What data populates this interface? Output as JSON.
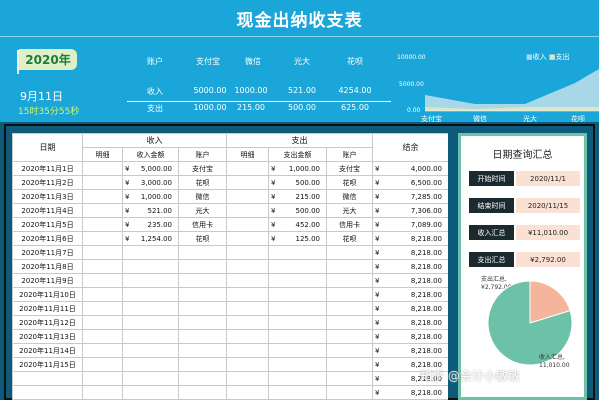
{
  "title": "现金出纳收支表",
  "badge": {
    "year": "2020年"
  },
  "today_date": "9月11日",
  "current_time": "15时35分55秒",
  "summary": {
    "headers": [
      "账户",
      "支付宝",
      "微信",
      "光大",
      "花呗"
    ],
    "rows": [
      {
        "label": "收入",
        "values": [
          "5000.00",
          "1000.00",
          "521.00",
          "4254.00"
        ]
      },
      {
        "label": "支出",
        "values": [
          "1000.00",
          "215.00",
          "500.00",
          "625.00"
        ]
      }
    ]
  },
  "mini_chart": {
    "legend": [
      "收入",
      "支出"
    ],
    "y_labels": [
      "10000.00",
      "5000.00",
      "0.00"
    ],
    "x_labels": [
      "支付宝",
      "微信",
      "光大",
      "花呗"
    ],
    "colors": {
      "income": "#a8d8e8",
      "expense": "#d9e7c7"
    }
  },
  "table": {
    "group_headers": {
      "date": "日期",
      "income": "收入",
      "expense": "支出",
      "balance": "结余"
    },
    "sub_headers": {
      "detail": "明细",
      "income_amount": "收入金额",
      "income_account": "账户",
      "expense_detail": "明细",
      "expense_amount": "支出金额",
      "expense_account": "账户"
    },
    "currency": "¥",
    "rows": [
      {
        "date": "2020年11月1日",
        "in_amt": "5,000.00",
        "in_acc": "支付宝",
        "out_amt": "1,000.00",
        "out_acc": "支付宝",
        "bal": "4,000.00"
      },
      {
        "date": "2020年11月2日",
        "in_amt": "3,000.00",
        "in_acc": "花呗",
        "out_amt": "500.00",
        "out_acc": "花呗",
        "bal": "6,500.00"
      },
      {
        "date": "2020年11月3日",
        "in_amt": "1,000.00",
        "in_acc": "微信",
        "out_amt": "215.00",
        "out_acc": "微信",
        "bal": "7,285.00"
      },
      {
        "date": "2020年11月4日",
        "in_amt": "521.00",
        "in_acc": "光大",
        "out_amt": "500.00",
        "out_acc": "光大",
        "bal": "7,306.00"
      },
      {
        "date": "2020年11月5日",
        "in_amt": "235.00",
        "in_acc": "信用卡",
        "out_amt": "452.00",
        "out_acc": "信用卡",
        "bal": "7,089.00"
      },
      {
        "date": "2020年11月6日",
        "in_amt": "1,254.00",
        "in_acc": "花呗",
        "out_amt": "125.00",
        "out_acc": "花呗",
        "bal": "8,218.00"
      },
      {
        "date": "2020年11月7日",
        "in_amt": "",
        "in_acc": "",
        "out_amt": "",
        "out_acc": "",
        "bal": "8,218.00"
      },
      {
        "date": "2020年11月8日",
        "in_amt": "",
        "in_acc": "",
        "out_amt": "",
        "out_acc": "",
        "bal": "8,218.00"
      },
      {
        "date": "2020年11月9日",
        "in_amt": "",
        "in_acc": "",
        "out_amt": "",
        "out_acc": "",
        "bal": "8,218.00"
      },
      {
        "date": "2020年11月10日",
        "in_amt": "",
        "in_acc": "",
        "out_amt": "",
        "out_acc": "",
        "bal": "8,218.00"
      },
      {
        "date": "2020年11月11日",
        "in_amt": "",
        "in_acc": "",
        "out_amt": "",
        "out_acc": "",
        "bal": "8,218.00"
      },
      {
        "date": "2020年11月12日",
        "in_amt": "",
        "in_acc": "",
        "out_amt": "",
        "out_acc": "",
        "bal": "8,218.00"
      },
      {
        "date": "2020年11月13日",
        "in_amt": "",
        "in_acc": "",
        "out_amt": "",
        "out_acc": "",
        "bal": "8,218.00"
      },
      {
        "date": "2020年11月14日",
        "in_amt": "",
        "in_acc": "",
        "out_amt": "",
        "out_acc": "",
        "bal": "8,218.00"
      },
      {
        "date": "2020年11月15日",
        "in_amt": "",
        "in_acc": "",
        "out_amt": "",
        "out_acc": "",
        "bal": "8,218.00"
      },
      {
        "date": "",
        "in_amt": "",
        "in_acc": "",
        "out_amt": "",
        "out_acc": "",
        "bal": "8,218.00"
      },
      {
        "date": "",
        "in_amt": "",
        "in_acc": "",
        "out_amt": "",
        "out_acc": "",
        "bal": "8,218.00"
      }
    ]
  },
  "query_panel": {
    "title": "日期查询汇总",
    "start_label": "开始时间",
    "start_value": "2020/11/1",
    "end_label": "结束时间",
    "end_value": "2020/11/15",
    "income_label": "收入汇总",
    "income_value": "¥11,010.00",
    "expense_label": "支出汇总",
    "expense_value": "¥2,792.00",
    "pie": {
      "expense_label": "支出汇总,",
      "expense_value": "¥2,792.00",
      "income_label": "收入汇总,",
      "income_value": "11,010.00",
      "colors": {
        "income": "#6cc1a9",
        "expense": "#f5b59c"
      }
    }
  },
  "watermark": "知乎 @会计小敏敏"
}
